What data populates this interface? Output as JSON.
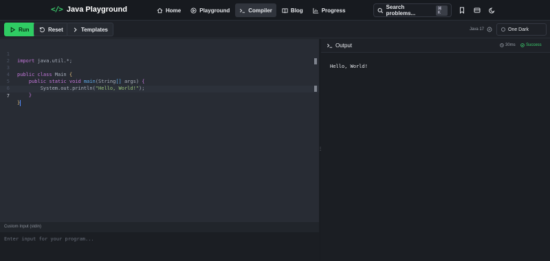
{
  "app": {
    "title": "Java Playground",
    "logo_icon": "</>"
  },
  "nav": [
    {
      "label": "Home",
      "icon": "home-icon"
    },
    {
      "label": "Playground",
      "icon": "play-circle-icon"
    },
    {
      "label": "Compiler",
      "icon": "terminal-icon",
      "active": true
    },
    {
      "label": "Blog",
      "icon": "book-icon"
    },
    {
      "label": "Progress",
      "icon": "bar-chart-icon"
    }
  ],
  "search": {
    "label": "Search problems...",
    "shortcut": "⌘ K"
  },
  "toolbar": {
    "run_label": "Run",
    "reset_label": "Reset",
    "templates_label": "Templates",
    "language": "Java 17",
    "theme": "One Dark"
  },
  "editor": {
    "current_line": 7,
    "line_numbers": [
      "1",
      "2",
      "3",
      "4",
      "5",
      "6",
      "7"
    ],
    "lines": [
      "import java.util.*;",
      "",
      "public class Main {",
      "    public static void main(String[] args) {",
      "        System.out.println(\"Hello, World!\");",
      "    }",
      "}"
    ]
  },
  "stdin": {
    "label": "Custom Input (stdin)",
    "placeholder": "Enter input for your program..."
  },
  "output": {
    "title": "Output",
    "time": "30ms",
    "status": "Success",
    "text": "Hello, World!"
  },
  "colors": {
    "accent": "#2fcc63",
    "background": "#1e2127",
    "editor_bg": "#282c34"
  }
}
